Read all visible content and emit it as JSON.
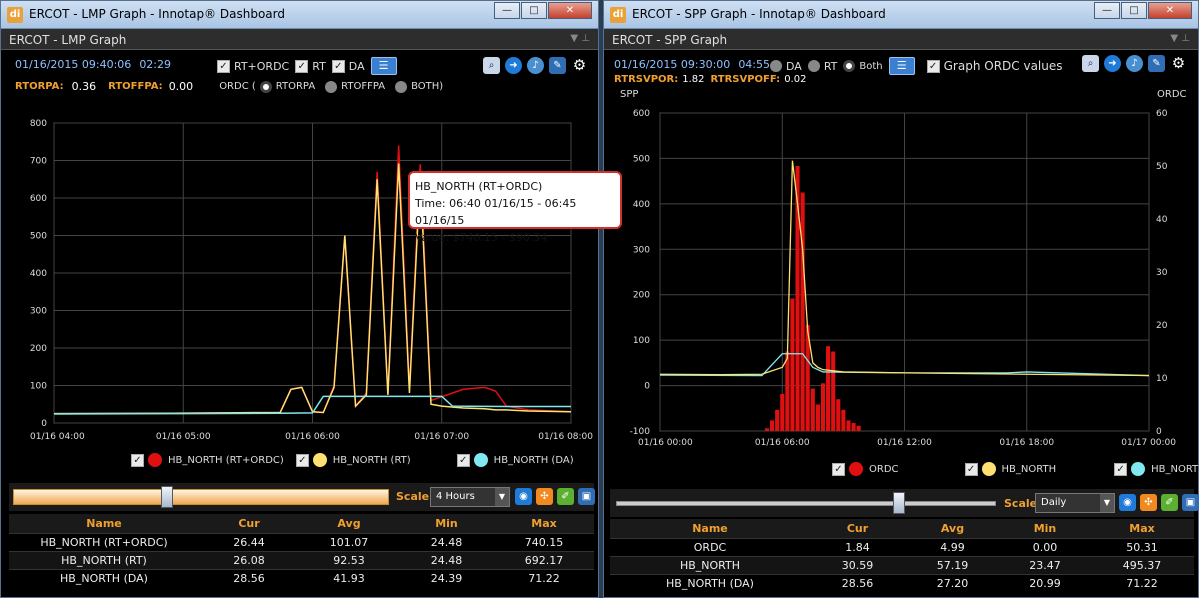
{
  "lmp": {
    "window_title": "ERCOT - LMP Graph - Innotap® Dashboard",
    "panel_title": "ERCOT - LMP Graph",
    "timestamp": "01/16/2015 09:40:06",
    "countdown": "02:29",
    "options": {
      "rt_ordc": "RT+ORDC",
      "rt": "RT",
      "da": "DA"
    },
    "rtorpa_label": "RTORPA:",
    "rtorpa_value": "0.36",
    "rtoffpa_label": "RTOFFPA:",
    "rtoffpa_value": "0.00",
    "ordc_label": "ORDC (",
    "ordc_radio": {
      "rtorpa": "RTORPA",
      "rtoffpa": "RTOFFPA",
      "both": "BOTH)"
    },
    "legend": [
      "HB_NORTH (RT+ORDC)",
      "HB_NORTH (RT)",
      "HB_NORTH (DA)"
    ],
    "scale_label": "Scale:",
    "scale_value": "4 Hours",
    "table": {
      "headers": [
        "Name",
        "Cur",
        "Avg",
        "Min",
        "Max"
      ],
      "rows": [
        [
          "HB_NORTH (RT+ORDC)",
          "26.44",
          "101.07",
          "24.48",
          "740.15"
        ],
        [
          "HB_NORTH (RT)",
          "26.08",
          "92.53",
          "24.48",
          "692.17"
        ],
        [
          "HB_NORTH (DA)",
          "28.56",
          "41.93",
          "24.39",
          "71.22"
        ]
      ]
    },
    "tooltip": {
      "line1": "HB_NORTH (RT+ORDC)",
      "line2": "Time: 06:40 01/16/15 - 06:45 01/16/15",
      "line3": "Value: $740.15 - $90.34"
    }
  },
  "spp": {
    "window_title": "ERCOT - SPP Graph - Innotap® Dashboard",
    "panel_title": "ERCOT - SPP Graph",
    "timestamp": "01/16/2015 09:30:00",
    "countdown": "04:55",
    "radios": {
      "da": "DA",
      "rt": "RT",
      "both": "Both"
    },
    "graph_ordc": "Graph ORDC values",
    "rtrsvpor_label": "RTRSVPOR:",
    "rtrsvpor_value": "1.82",
    "rtrsvpoff_label": "RTRSVPOFF:",
    "rtrsvpoff_value": "0.02",
    "y_left_label": "SPP",
    "y_right_label": "ORDC",
    "legend": [
      "ORDC",
      "HB_NORTH",
      "HB_NORTH(DA)"
    ],
    "scale_label": "Scale:",
    "scale_value": "Daily",
    "table": {
      "headers": [
        "Name",
        "Cur",
        "Avg",
        "Min",
        "Max"
      ],
      "rows": [
        [
          "ORDC",
          "1.84",
          "4.99",
          "0.00",
          "50.31"
        ],
        [
          "HB_NORTH",
          "30.59",
          "57.19",
          "23.47",
          "495.37"
        ],
        [
          "HB_NORTH (DA)",
          "28.56",
          "27.20",
          "20.99",
          "71.22"
        ]
      ]
    }
  },
  "colors": {
    "rt_ordc": "#e01010",
    "rt": "#ffe070",
    "da": "#80e8f0",
    "ordc_bar": "#e01010"
  },
  "chart_data": [
    {
      "type": "line",
      "x_ticks": [
        "01/16 04:00",
        "01/16 05:00",
        "01/16 06:00",
        "01/16 07:00",
        "01/16 08:00"
      ],
      "xlim": [
        "01/16 04:00",
        "01/16 08:00"
      ],
      "ylim": [
        0,
        800
      ],
      "y_ticks": [
        0,
        100,
        200,
        300,
        400,
        500,
        600,
        700,
        800
      ],
      "grid": true,
      "series": [
        {
          "name": "HB_NORTH (RT+ORDC)",
          "x": [
            "04:00",
            "04:55",
            "05:45",
            "05:50",
            "05:55",
            "06:00",
            "06:05",
            "06:10",
            "06:15",
            "06:20",
            "06:25",
            "06:30",
            "06:35",
            "06:40",
            "06:45",
            "06:50",
            "06:55",
            "07:00",
            "07:10",
            "07:20",
            "07:25",
            "07:30",
            "07:40",
            "08:00"
          ],
          "values": [
            25,
            26,
            28,
            90,
            95,
            30,
            28,
            100,
            500,
            45,
            80,
            670,
            75,
            740,
            90,
            690,
            60,
            70,
            90,
            95,
            85,
            45,
            35,
            30
          ]
        },
        {
          "name": "HB_NORTH (RT)",
          "x": [
            "04:00",
            "04:55",
            "05:45",
            "05:50",
            "05:55",
            "06:00",
            "06:05",
            "06:10",
            "06:15",
            "06:20",
            "06:25",
            "06:30",
            "06:35",
            "06:40",
            "06:45",
            "06:50",
            "06:55",
            "07:00",
            "07:10",
            "07:20",
            "07:25",
            "07:30",
            "07:40",
            "08:00"
          ],
          "values": [
            25,
            26,
            28,
            90,
            95,
            30,
            28,
            95,
            500,
            45,
            75,
            650,
            75,
            692,
            80,
            660,
            50,
            45,
            40,
            38,
            35,
            35,
            32,
            30
          ]
        },
        {
          "name": "HB_NORTH (DA)",
          "x": [
            "04:00",
            "05:00",
            "05:45",
            "06:00",
            "06:05",
            "07:00",
            "07:05",
            "07:30",
            "08:00"
          ],
          "values": [
            24,
            25,
            26,
            27,
            71,
            71,
            45,
            44,
            44
          ]
        }
      ]
    },
    {
      "type": "line+bar",
      "x_ticks": [
        "01/16 00:00",
        "01/16 06:00",
        "01/16 12:00",
        "01/16 18:00",
        "01/17 00:00"
      ],
      "xlim": [
        "01/16 00:00",
        "01/17 00:00"
      ],
      "ylim_left": [
        -100,
        600
      ],
      "ylim_right": [
        0,
        60
      ],
      "y_ticks_left": [
        -100,
        0,
        100,
        200,
        300,
        400,
        500,
        600
      ],
      "y_ticks_right": [
        0,
        10,
        20,
        30,
        40,
        50,
        60
      ],
      "grid": true,
      "series": [
        {
          "name": "HB_NORTH",
          "axis": "left",
          "x": [
            "00:00",
            "03:00",
            "05:00",
            "06:00",
            "06:15",
            "06:30",
            "06:45",
            "07:00",
            "07:15",
            "07:30",
            "07:45",
            "08:00",
            "09:00",
            "12:00",
            "18:00",
            "24:00"
          ],
          "values": [
            25,
            24,
            25,
            40,
            60,
            495,
            400,
            300,
            120,
            50,
            40,
            35,
            30,
            28,
            25,
            22
          ]
        },
        {
          "name": "HB_NORTH(DA)",
          "axis": "left",
          "x": [
            "00:00",
            "05:00",
            "06:00",
            "07:00",
            "07:30",
            "08:00",
            "12:00",
            "17:00",
            "18:00",
            "24:00"
          ],
          "values": [
            23,
            22,
            70,
            70,
            40,
            30,
            28,
            28,
            30,
            22
          ]
        },
        {
          "name": "ORDC",
          "axis": "right",
          "type": "bar",
          "x": [
            "05:15",
            "05:30",
            "05:45",
            "06:00",
            "06:15",
            "06:30",
            "06:45",
            "07:00",
            "07:15",
            "07:30",
            "07:45",
            "08:00",
            "08:15",
            "08:30",
            "08:45",
            "09:00",
            "09:15",
            "09:30",
            "09:45"
          ],
          "values": [
            0.5,
            2,
            4,
            7,
            15,
            25,
            50,
            45,
            20,
            8,
            5,
            9,
            16,
            15,
            6,
            4,
            2,
            1.5,
            1
          ]
        }
      ]
    }
  ]
}
